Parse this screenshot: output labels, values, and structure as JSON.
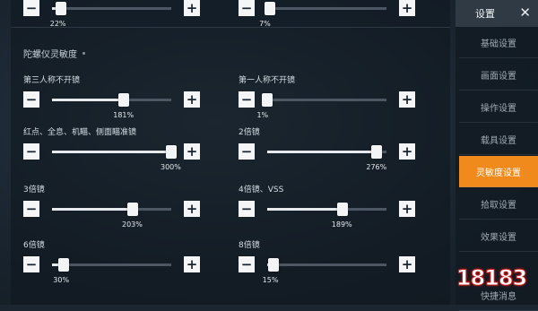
{
  "top_sliders": [
    {
      "percent_label": "22%",
      "value_pct": 22
    },
    {
      "percent_label": "7%",
      "value_pct": 7
    }
  ],
  "section_title": "陀螺仪灵敏度",
  "sliders": [
    {
      "label": "第三人称不开镜",
      "percent_label": "181%",
      "value_pct": 181
    },
    {
      "label": "第一人称不开镜",
      "percent_label": "1%",
      "value_pct": 1
    },
    {
      "label": "红点、全息、机瞄、侧面瞄准镜",
      "percent_label": "300%",
      "value_pct": 300
    },
    {
      "label": "2倍镜",
      "percent_label": "276%",
      "value_pct": 276
    },
    {
      "label": "3倍镜",
      "percent_label": "203%",
      "value_pct": 203
    },
    {
      "label": "4倍镜、VSS",
      "percent_label": "189%",
      "value_pct": 189
    },
    {
      "label": "6倍镜",
      "percent_label": "30%",
      "value_pct": 30
    },
    {
      "label": "8倍镜",
      "percent_label": "15%",
      "value_pct": 15
    }
  ],
  "slider_max_pct": 300,
  "button_minus": "−",
  "button_plus": "+",
  "sidebar": {
    "title": "设置",
    "close_glyph": "✕",
    "items": [
      {
        "label": "基础设置",
        "active": false
      },
      {
        "label": "画面设置",
        "active": false
      },
      {
        "label": "操作设置",
        "active": false
      },
      {
        "label": "载具设置",
        "active": false
      },
      {
        "label": "灵敏度设置",
        "active": true
      },
      {
        "label": "拾取设置",
        "active": false
      },
      {
        "label": "效果设置",
        "active": false
      },
      {
        "label": "快捷消息",
        "active": false
      }
    ]
  },
  "watermark": "18183",
  "colors": {
    "accent": "#f08a1c",
    "watermark_red": "#cc1f1f"
  }
}
